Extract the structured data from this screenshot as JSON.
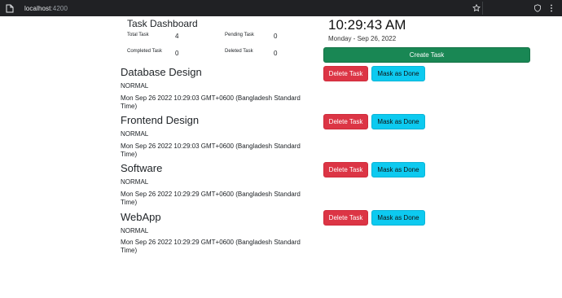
{
  "browser": {
    "url_host": "localhost",
    "url_port": ":4200"
  },
  "dashboard": {
    "title": "Task Dashboard",
    "stats": {
      "total_label": "Total Task",
      "total_value": "4",
      "pending_label": "Pending Task",
      "pending_value": "0",
      "completed_label": "Completed Task",
      "completed_value": "0",
      "deleted_label": "Deleted Task",
      "deleted_value": "0"
    }
  },
  "clock": {
    "time": "10:29:43 AM",
    "date": "Monday - Sep 26, 2022"
  },
  "create_button": "Create Task",
  "tasks": [
    {
      "title": "Database Design",
      "priority": "NORMAL",
      "created": "Mon Sep 26 2022 10:29:03 GMT+0600 (Bangladesh Standard Time)",
      "delete_label": "Delete Task",
      "done_label": "Mask as Done"
    },
    {
      "title": "Frontend Design",
      "priority": "NORMAL",
      "created": "Mon Sep 26 2022 10:29:03 GMT+0600 (Bangladesh Standard Time)",
      "delete_label": "Delete Task",
      "done_label": "Mask as Done"
    },
    {
      "title": "Software",
      "priority": "NORMAL",
      "created": "Mon Sep 26 2022 10:29:29 GMT+0600 (Bangladesh Standard Time)",
      "delete_label": "Delete Task",
      "done_label": "Mask as Done"
    },
    {
      "title": "WebApp",
      "priority": "NORMAL",
      "created": "Mon Sep 26 2022 10:29:29 GMT+0600 (Bangladesh Standard Time)",
      "delete_label": "Delete Task",
      "done_label": "Mask as Done"
    }
  ],
  "colors": {
    "create": "#198754",
    "delete": "#dc3545",
    "done": "#0dcaf0"
  }
}
